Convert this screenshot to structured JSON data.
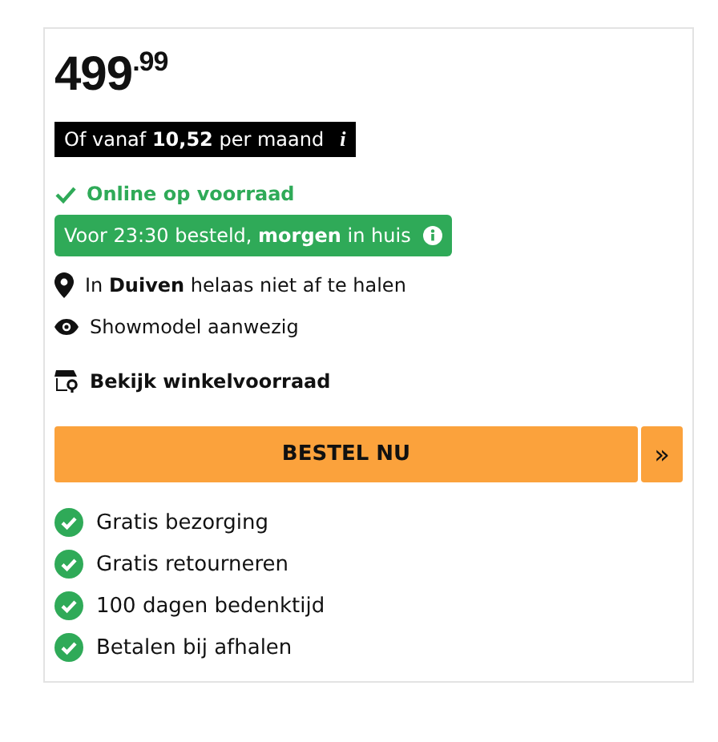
{
  "price": "499$^{.99}$",
  "financing": {
    "text": "Of vanaf **10,52** per maand",
    "info": "i"
  },
  "stock": {
    "text": "Online op voorraad",
    "in_stock": true
  },
  "delivery": "Voor 23:30 besteld, **morgen** in huis",
  "pickup": "In **Duiven** helaas niet af te halen",
  "showmodel": "Showmodel aanwezig",
  "store_link": "Bekijk winkelvoorraad",
  "order_button": {
    "label": "BESTEL NU",
    "more": "»"
  },
  "benefits": [
    {
      "text": "Gratis bezorging"
    },
    {
      "text": "Gratis retourneren"
    },
    {
      "text": "100 dagen bedenktijd"
    },
    {
      "text": "Betalen bij afhalen"
    }
  ]
}
